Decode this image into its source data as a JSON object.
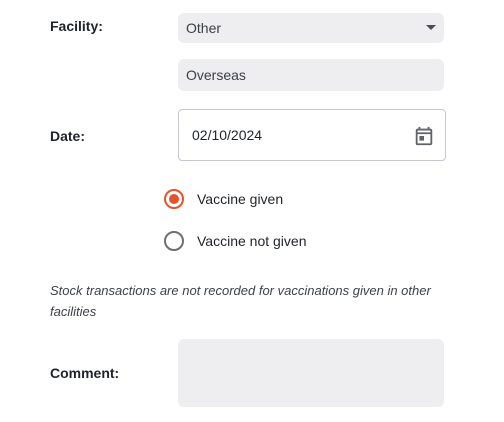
{
  "facility": {
    "label": "Facility:",
    "selected_option": "Other",
    "other_facility_value": "Overseas"
  },
  "date": {
    "label": "Date:",
    "value": "02/10/2024",
    "icon": "calendar-icon"
  },
  "vaccine_status": {
    "options": [
      {
        "label": "Vaccine given",
        "checked": true
      },
      {
        "label": "Vaccine not given",
        "checked": false
      }
    ]
  },
  "note": "Stock transactions are not recorded for vaccinations given in other facilities",
  "comment": {
    "label": "Comment:",
    "value": ""
  },
  "colors": {
    "accent": "#e5532d",
    "field_background": "#eeeef0",
    "border": "#c5c8cc"
  }
}
